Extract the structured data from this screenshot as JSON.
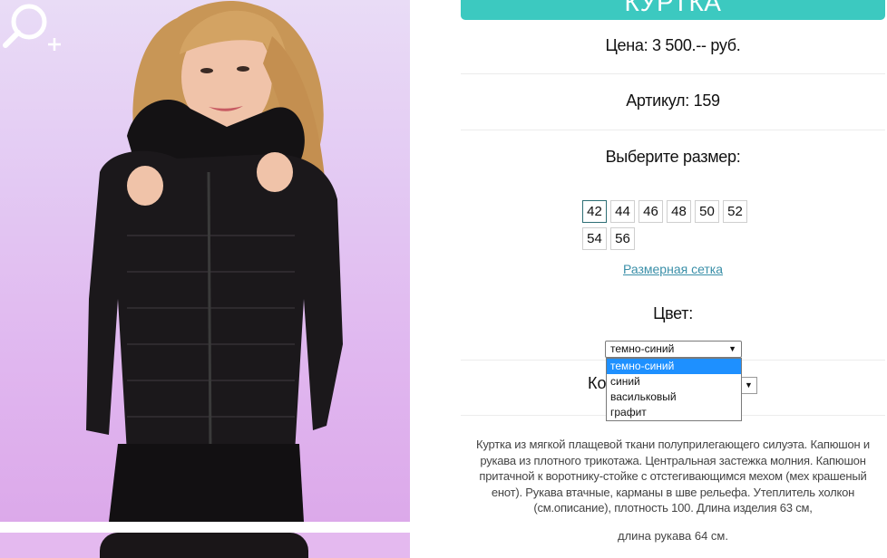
{
  "product": {
    "title": "КУРТКА",
    "price": "Цена: 3 500.-- руб.",
    "sku": "Артикул: 159",
    "size_label": "Выберите размер:",
    "sizes": [
      "42",
      "44",
      "46",
      "48",
      "50",
      "52",
      "54",
      "56"
    ],
    "selected_size": "42",
    "size_chart_link": "Размерная сетка",
    "color_label": "Цвет:",
    "color_select_value": "темно-синий",
    "color_options": [
      "темно-синий",
      "синий",
      "васильковый",
      "графит"
    ],
    "quantity_label": "Ко",
    "description": "Куртка из мягкой плащевой ткани полуприлегающего силуэта. Капюшон и рукава из плотного трикотажа. Центральная застежка молния. Капюшон притачной к воротнику-стойке с отстегивающимся мехом (мех крашеный енот). Рукава втачные, карманы в шве рельефа. Утеплитель холкон (см.описание), плотность 100. Длина изделия 63 см,",
    "description_tail": "длина рукава 64 см."
  },
  "icons": {
    "zoom": "zoom-in-icon",
    "dropdown_arrow": "triangle-down-icon"
  },
  "colors": {
    "accent": "#3cc9c0",
    "link": "#3a8fa8",
    "dropdown_highlight": "#1e90ff"
  }
}
